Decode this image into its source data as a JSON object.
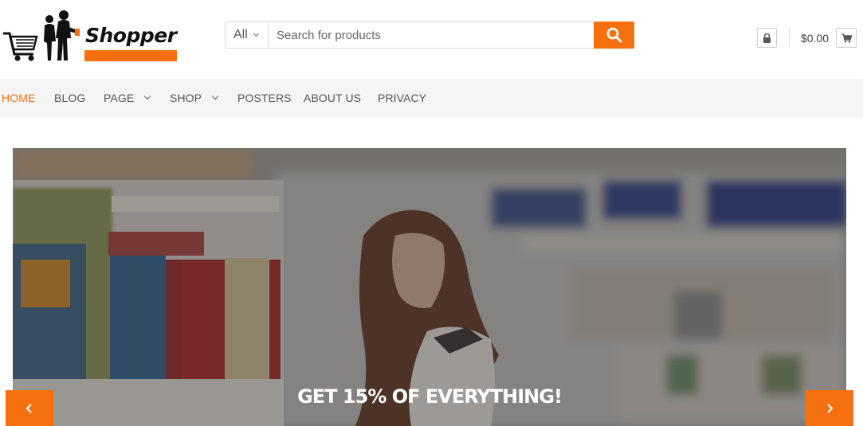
{
  "brand": {
    "name": "Shopper",
    "accent_color": "#f7700f"
  },
  "search": {
    "category": "All",
    "placeholder": "Search for products",
    "button_icon": "search-icon"
  },
  "account": {
    "icon": "lock-icon"
  },
  "cart": {
    "total": "$0.00",
    "icon": "cart-icon"
  },
  "nav": {
    "items": [
      {
        "label": "HOME",
        "active": true,
        "has_dropdown": false
      },
      {
        "label": "BLOG",
        "active": false,
        "has_dropdown": false
      },
      {
        "label": "PAGE",
        "active": false,
        "has_dropdown": true
      },
      {
        "label": "SHOP",
        "active": false,
        "has_dropdown": true
      },
      {
        "label": "POSTERS",
        "active": false,
        "has_dropdown": false
      },
      {
        "label": "ABOUT US",
        "active": false,
        "has_dropdown": false
      },
      {
        "label": "PRIVACY",
        "active": false,
        "has_dropdown": false
      }
    ]
  },
  "slider": {
    "caption": "GET 15% OF EVERYTHING!",
    "prev_icon": "chevron-left-icon",
    "next_icon": "chevron-right-icon"
  }
}
